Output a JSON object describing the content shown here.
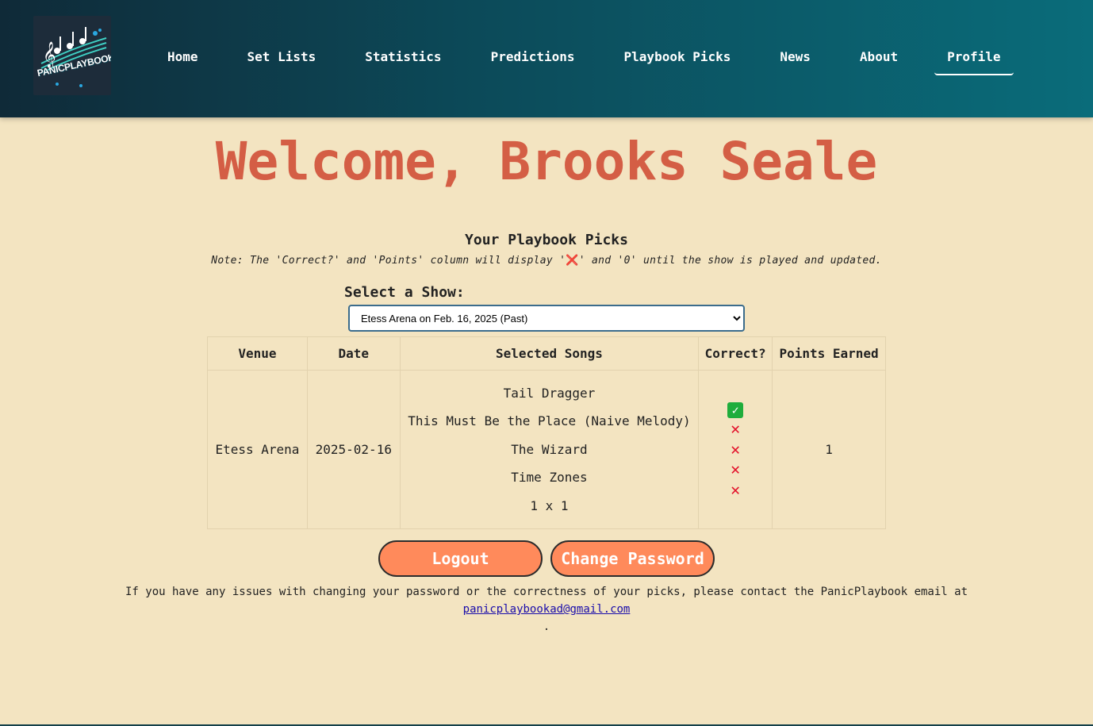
{
  "logo": {
    "alt_text": "PANICPLAYBOOK"
  },
  "nav": [
    {
      "label": "Home"
    },
    {
      "label": "Set Lists"
    },
    {
      "label": "Statistics"
    },
    {
      "label": "Predictions"
    },
    {
      "label": "Playbook Picks"
    },
    {
      "label": "News"
    },
    {
      "label": "About"
    },
    {
      "label": "Profile",
      "active": true
    }
  ],
  "welcome": "Welcome, Brooks Seale",
  "picks": {
    "title": "Your Playbook Picks",
    "note_prefix": "Note: The 'Correct?' and 'Points' column will display '",
    "note_x": "❌",
    "note_suffix": "' and '0' until the show is played and updated."
  },
  "show_select": {
    "label": "Select a Show:",
    "selected": "Etess Arena on Feb. 16, 2025 (Past)"
  },
  "table": {
    "headers": [
      "Venue",
      "Date",
      "Selected Songs",
      "Correct?",
      "Points Earned"
    ],
    "row": {
      "venue": "Etess Arena",
      "date": "2025-02-16",
      "songs": [
        "Tail Dragger",
        "This Must Be the Place (Naive Melody)",
        "The Wizard",
        "Time Zones",
        "1 x 1"
      ],
      "correct": [
        "✓",
        "✕",
        "✕",
        "✕",
        "✕"
      ],
      "points": "1"
    }
  },
  "buttons": {
    "logout": "Logout",
    "change_password": "Change Password"
  },
  "footer": {
    "text": "If you have any issues with changing your password or the correctness of your picks, please contact the PanicPlaybook email at",
    "email": "panicplaybookad@gmail.com",
    "trailing": "."
  },
  "colors": {
    "accent": "#d45e45",
    "button": "#ff8a5b",
    "background": "#f3e4c1",
    "header_start": "#0f2a38",
    "header_end": "#0a6c7a"
  }
}
